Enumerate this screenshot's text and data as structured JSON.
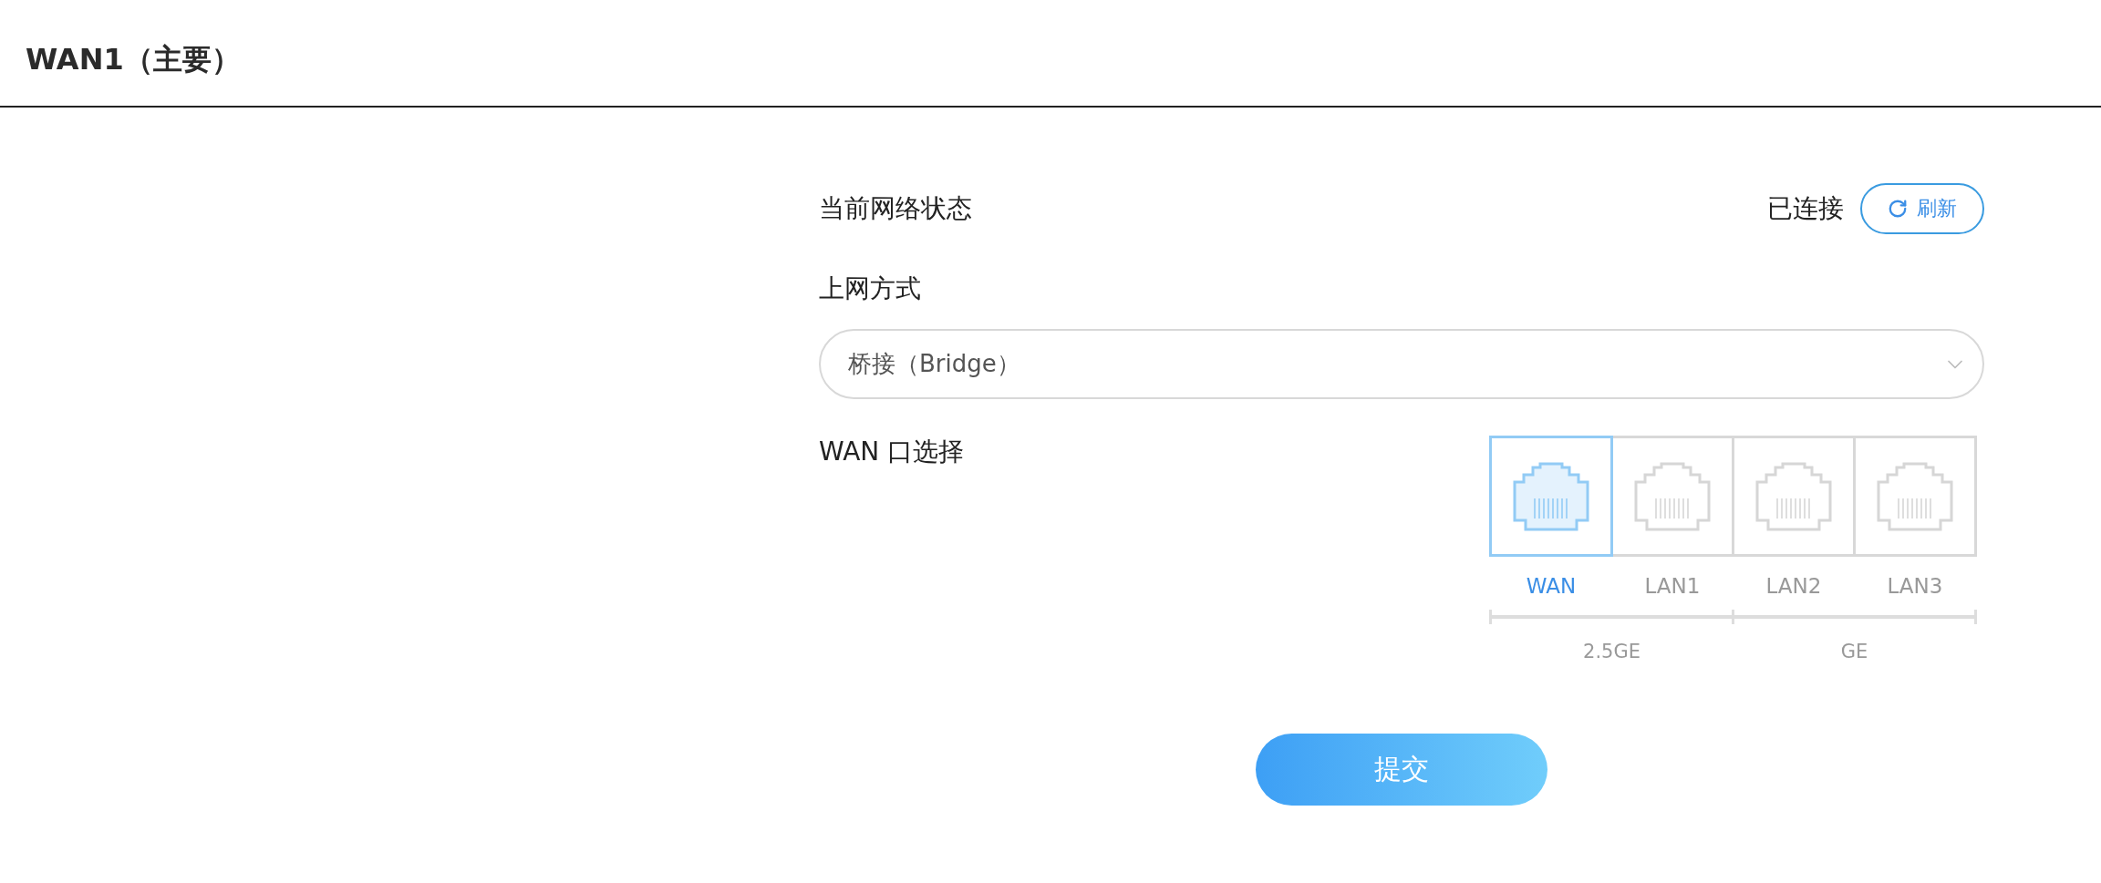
{
  "title": "WAN1（主要）",
  "status": {
    "label": "当前网络状态",
    "value": "已连接",
    "refresh_label": "刷新"
  },
  "mode": {
    "label": "上网方式",
    "value": "桥接（Bridge）"
  },
  "wan_port": {
    "label": "WAN 口选择",
    "speed_groups": [
      {
        "label": "2.5GE",
        "ports": [
          {
            "label": "WAN",
            "selected": true
          },
          {
            "label": "LAN1",
            "selected": false
          }
        ]
      },
      {
        "label": "GE",
        "ports": [
          {
            "label": "LAN2",
            "selected": false
          },
          {
            "label": "LAN3",
            "selected": false
          }
        ]
      }
    ]
  },
  "submit_label": "提交"
}
